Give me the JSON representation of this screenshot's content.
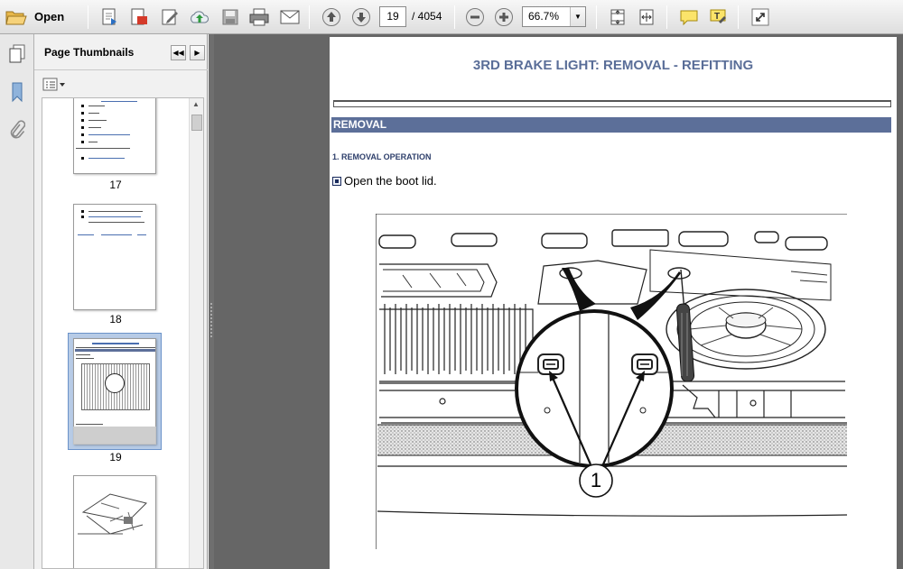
{
  "toolbar": {
    "open_label": "Open",
    "current_page": "19",
    "page_total": "/ 4054",
    "zoom": "66.7%",
    "icons": [
      "folder-open-icon",
      "create-pdf-icon",
      "edit-pdf-icon",
      "sign-icon",
      "upload-icon",
      "save-icon",
      "print-icon",
      "email-icon",
      "previous-page-icon",
      "next-page-icon",
      "zoom-out-icon",
      "zoom-in-icon",
      "fit-page-icon",
      "fit-width-icon",
      "comment-icon",
      "highlight-icon",
      "fullscreen-icon"
    ]
  },
  "rail": {
    "icons": [
      "page-thumbnails-icon",
      "bookmarks-icon",
      "attachments-icon"
    ]
  },
  "panel": {
    "title": "Page Thumbnails",
    "thumbnails": [
      {
        "label": "17"
      },
      {
        "label": "18"
      },
      {
        "label": "19",
        "selected": true
      },
      {
        "label": ""
      }
    ]
  },
  "document": {
    "title": "3RD BRAKE LIGHT: REMOVAL - REFITTING",
    "section": "REMOVAL",
    "step_heading": "1. REMOVAL OPERATION",
    "instruction": "Open the boot lid.",
    "callout": "1"
  },
  "colors": {
    "section_bar": "#5c6f99",
    "title_text": "#5a6e98",
    "viewer_background": "#666666"
  }
}
